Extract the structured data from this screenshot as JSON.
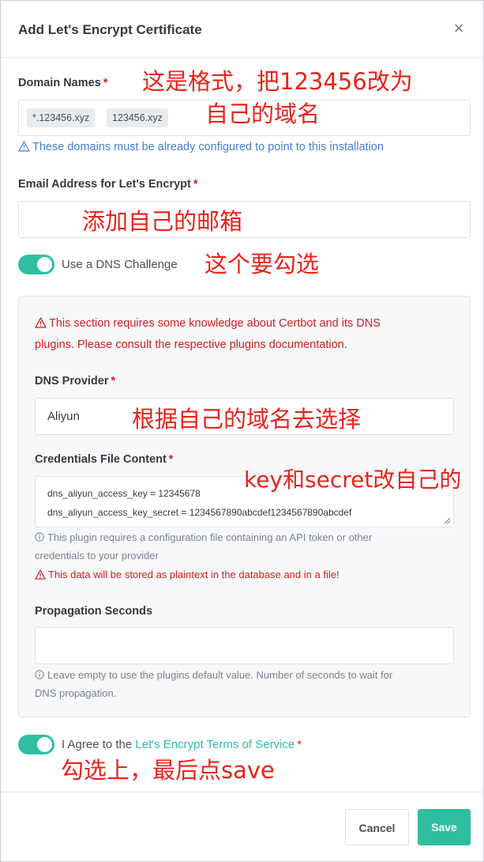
{
  "modal": {
    "title": "Add Let's Encrypt Certificate",
    "close_symbol": "×"
  },
  "domain_names": {
    "label": "Domain Names",
    "required_mark": "*",
    "tags": [
      "*.123456.xyz",
      "123456.xyz"
    ],
    "hint": "These domains must be already configured to point to this installation"
  },
  "email": {
    "label": "Email Address for Let's Encrypt",
    "required_mark": "*",
    "value": ""
  },
  "dns_challenge": {
    "label": "Use a DNS Challenge",
    "checked": true
  },
  "dns_section": {
    "warning_line1": "This section requires some knowledge about Certbot and its DNS",
    "warning_line2": "plugins. Please consult the respective plugins documentation.",
    "provider_label": "DNS Provider",
    "provider_required": "*",
    "provider_value": "Aliyun",
    "credentials_label": "Credentials File Content",
    "credentials_required": "*",
    "credentials_lines": [
      "dns_aliyun_access_key = 12345678",
      "dns_aliyun_access_key_secret = 1234567890abcdef1234567890abcdef"
    ],
    "credentials_info_line1": "This plugin requires a configuration file containing an API token or other",
    "credentials_info_line2": "credentials to your provider",
    "credentials_warning": "This data will be stored as plaintext in the database and in a file!",
    "propagation_label": "Propagation Seconds",
    "propagation_value": "",
    "propagation_info_line1": "Leave empty to use the plugins default value. Number of seconds to wait for",
    "propagation_info_line2": "DNS propagation."
  },
  "agree": {
    "prefix": "I Agree to the",
    "link": "Let's Encrypt Terms of Service",
    "required_mark": "*",
    "checked": true
  },
  "buttons": {
    "cancel": "Cancel",
    "save": "Save"
  },
  "annotations": {
    "domain_1": "这是格式，把123456改为",
    "domain_2": "自己的域名",
    "email": "添加自己的邮箱",
    "dns_toggle": "这个要勾选",
    "provider": "根据自己的域名去选择",
    "credentials": "key和secret改自己的",
    "agree": "勾选上，最后点save"
  },
  "colors": {
    "accent": "#2fbfa0",
    "danger": "#cd201f",
    "info": "#467fcf",
    "annotation": "#e8231a"
  },
  "icons": [
    "close-icon",
    "warning-triangle-icon",
    "info-circle-icon",
    "resize-handle-icon"
  ]
}
